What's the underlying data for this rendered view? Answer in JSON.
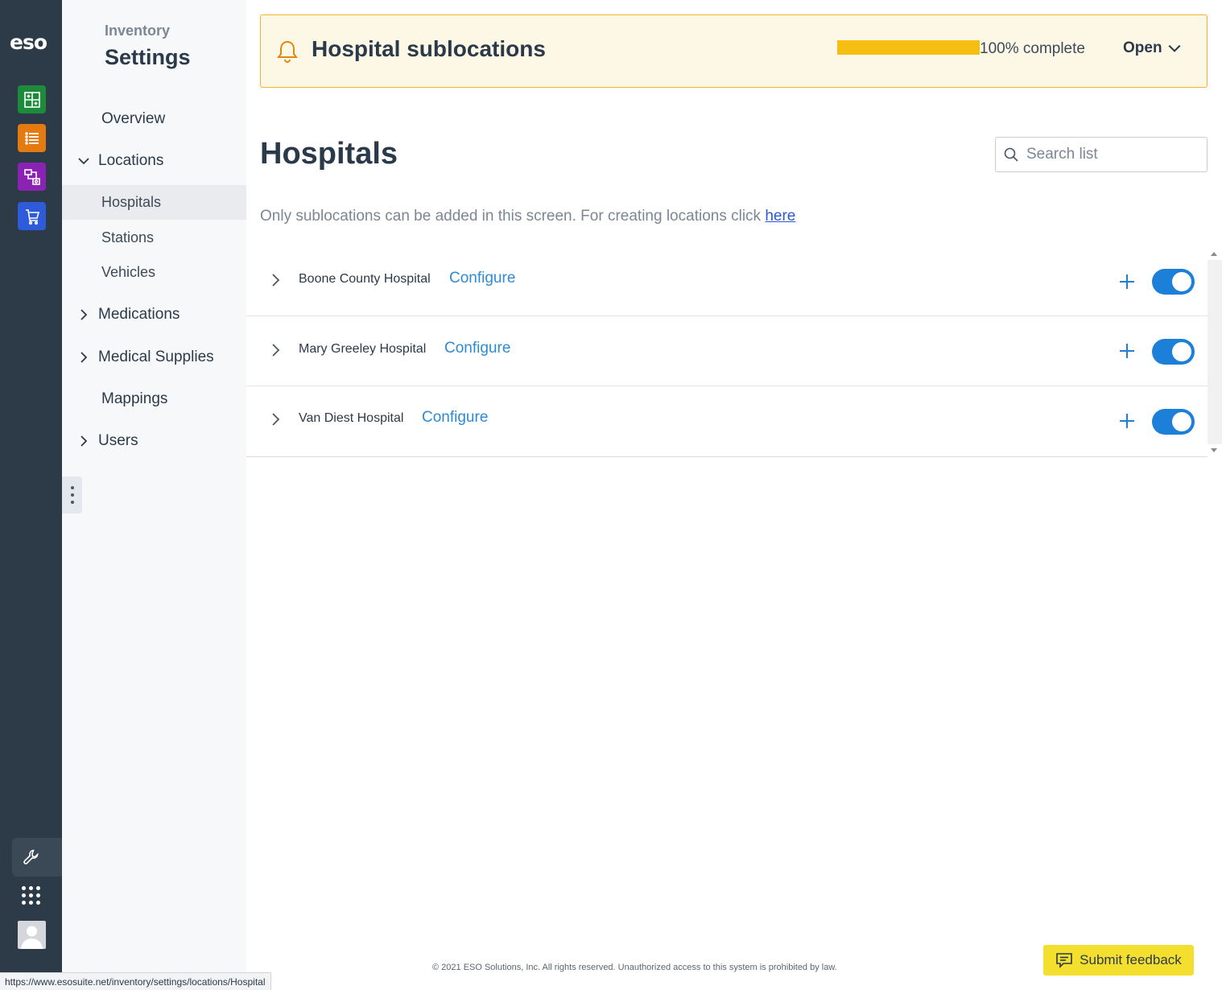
{
  "rail": {
    "logo": "eso",
    "apps": [
      {
        "icon": "hospital-grid-icon",
        "color": "#1e8a3c"
      },
      {
        "icon": "list-icon",
        "color": "#e47b10"
      },
      {
        "icon": "workflow-icon",
        "color": "#8a22b3"
      },
      {
        "icon": "cart-icon",
        "color": "#2d5bd9"
      }
    ],
    "bottom": [
      {
        "icon": "wrench-icon"
      },
      {
        "icon": "apps-grid-icon"
      },
      {
        "icon": "user-avatar-icon"
      }
    ]
  },
  "nav": {
    "eyebrow": "Inventory",
    "title": "Settings",
    "items": [
      {
        "label": "Overview"
      },
      {
        "label": "Locations",
        "expanded": true
      },
      {
        "label": "Hospitals",
        "active": true
      },
      {
        "label": "Stations"
      },
      {
        "label": "Vehicles"
      },
      {
        "label": "Medications",
        "expanded": false
      },
      {
        "label": "Medical Supplies",
        "expanded": false
      },
      {
        "label": "Mappings"
      },
      {
        "label": "Users",
        "expanded": false
      }
    ]
  },
  "banner": {
    "title": "Hospital sublocations",
    "progress_percent": 100,
    "progress_text": "100% complete",
    "open_label": "Open",
    "accent": "#f6bd12"
  },
  "page": {
    "title": "Hospitals",
    "search_placeholder": "Search list",
    "info_text": "Only sublocations can be added in this screen. For creating locations click ",
    "info_link": "here"
  },
  "hospitals": [
    {
      "name": "Boone County Hospital",
      "action": "Configure",
      "enabled": true
    },
    {
      "name": "Mary Greeley Hospital",
      "action": "Configure",
      "enabled": true
    },
    {
      "name": "Van Diest Hospital",
      "action": "Configure",
      "enabled": true
    }
  ],
  "footer": {
    "copyright": "© 2021 ESO Solutions, Inc. All rights reserved. Unauthorized access to this system is prohibited by law.",
    "feedback_label": "Submit feedback",
    "status_url": "https://www.esosuite.net/inventory/settings/locations/Hospital"
  }
}
